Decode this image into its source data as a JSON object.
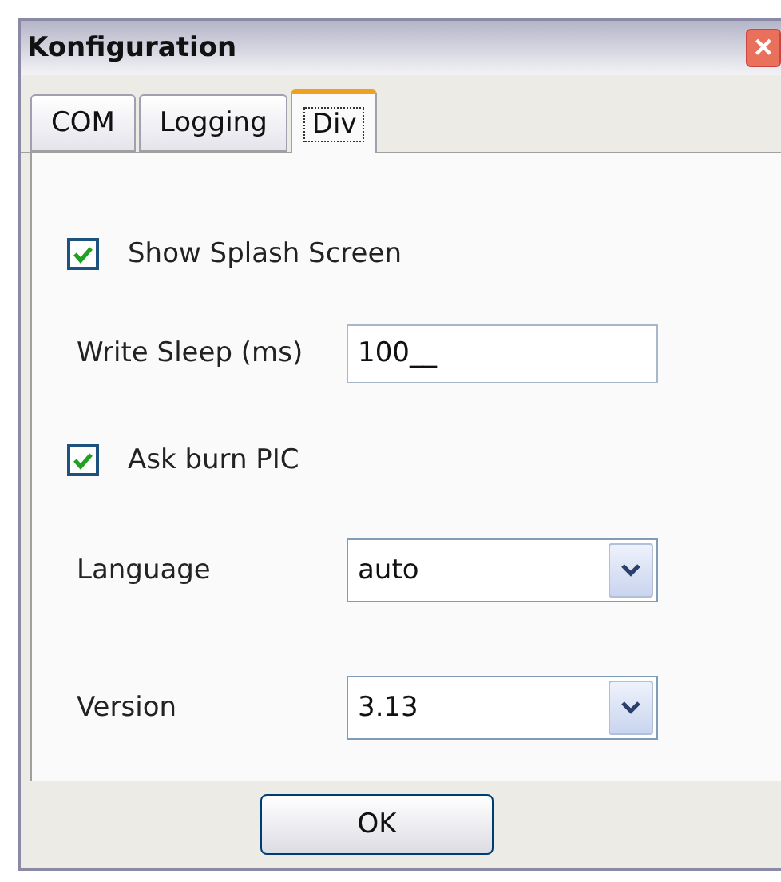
{
  "window": {
    "title": "Konfiguration",
    "close": "×"
  },
  "tabs": [
    {
      "label": "COM",
      "selected": false
    },
    {
      "label": "Logging",
      "selected": false
    },
    {
      "label": "Div",
      "selected": true
    }
  ],
  "settings": [
    {
      "kind": "checkbox",
      "label": "Show Splash Screen",
      "checked": true
    },
    {
      "kind": "text",
      "label": "Write Sleep (ms)",
      "value": "100__"
    },
    {
      "kind": "checkbox",
      "label": "Ask burn PIC",
      "checked": true
    },
    {
      "kind": "select",
      "label": "Language",
      "value": "auto"
    },
    {
      "kind": "select",
      "label": "Version",
      "value": "3.13"
    }
  ],
  "buttons": [
    "OK"
  ]
}
